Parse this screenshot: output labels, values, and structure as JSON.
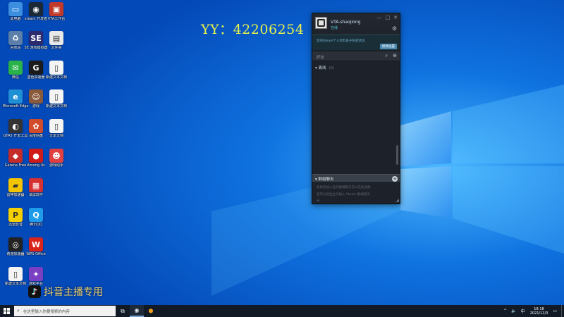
{
  "watermark": {
    "yy_text": "YY：42206254",
    "douyin_text": "抖音主播专用"
  },
  "desktop_icons": [
    {
      "label": "此电脑",
      "glyph": "▭",
      "color": "#3c8fe0"
    },
    {
      "label": "steam 开发者",
      "glyph": "◉",
      "color": "#1b2838"
    },
    {
      "label": "VTA工作台",
      "glyph": "▣",
      "color": "#c0392b"
    },
    {
      "label": "回收站",
      "glyph": "♻",
      "color": "#5b7fa8"
    },
    {
      "label": "SE 游戏模拟器",
      "glyph": "SE",
      "color": "#2d2b6e"
    },
    {
      "label": "文件夹",
      "glyph": "▤",
      "color": "#e9e9e9"
    },
    {
      "label": "微信",
      "glyph": "✉",
      "color": "#29b34a"
    },
    {
      "label": "蓝色加速器",
      "glyph": "G",
      "color": "#1b1b1b"
    },
    {
      "label": "新建文本文档",
      "glyph": "▯",
      "color": "#f4f4f4"
    },
    {
      "label": "Microsoft Edge",
      "glyph": "e",
      "color": "#1f8fd6"
    },
    {
      "label": "游戏",
      "glyph": "☺",
      "color": "#8a5a3c"
    },
    {
      "label": "新建文本文档",
      "glyph": "▯",
      "color": "#f4f4f4"
    },
    {
      "label": "GTA5 开发工具",
      "glyph": "◐",
      "color": "#333333"
    },
    {
      "label": "百度网盘",
      "glyph": "✿",
      "color": "#d24b2a"
    },
    {
      "label": "文本文档",
      "glyph": "▯",
      "color": "#f4f4f4"
    },
    {
      "label": "Garena Free",
      "glyph": "◆",
      "color": "#c42b2b"
    },
    {
      "label": "Among Us",
      "glyph": "●",
      "color": "#d01b1b"
    },
    {
      "label": "游戏助手",
      "glyph": "☻",
      "color": "#e04040"
    },
    {
      "label": "雷神加速器",
      "glyph": "▰",
      "color": "#f5c400"
    },
    {
      "label": "录屏软件",
      "glyph": "▦",
      "color": "#d63030"
    },
    {
      "label": "",
      "glyph": "",
      "color": ""
    },
    {
      "label": "迅雷影音",
      "glyph": "P",
      "color": "#f5d000"
    },
    {
      "label": "腾讯QQ",
      "glyph": "Q",
      "color": "#1e9bea"
    },
    {
      "label": "",
      "glyph": "",
      "color": ""
    },
    {
      "label": "奇游加速器",
      "glyph": "◎",
      "color": "#222222"
    },
    {
      "label": "WPS Office",
      "glyph": "W",
      "color": "#d9241c"
    },
    {
      "label": "",
      "glyph": "",
      "color": ""
    },
    {
      "label": "新建文本文档",
      "glyph": "▯",
      "color": "#f4f4f4"
    },
    {
      "label": "游戏平台",
      "glyph": "✦",
      "color": "#7a3fc2"
    }
  ],
  "steam": {
    "window_buttons": [
      "—",
      "□",
      "✕"
    ],
    "username": "VTA-shaojiong",
    "status": "在线",
    "notice_text": "您的Steam个人资料处于私密状态",
    "notice_button": "修改设置",
    "search_label": "好友",
    "offline_group": "离线",
    "offline_count": "(0)",
    "group_chat_label": "群组聊天",
    "group_chat_lines": [
      "您尚未加入任何群组聊天可以在此创建",
      "您可以前往主页加入 Steam 群组聊天",
      "天"
    ],
    "icons": {
      "gear": "gear-icon",
      "search": "search-icon",
      "add_friend": "add-friend-icon"
    }
  },
  "taskbar": {
    "search_placeholder": "在这里输入你要搜索的内容",
    "clock_time": "18:18",
    "clock_date": "2021/12/3",
    "tray_icons": [
      "^",
      "🔈",
      "中"
    ]
  }
}
